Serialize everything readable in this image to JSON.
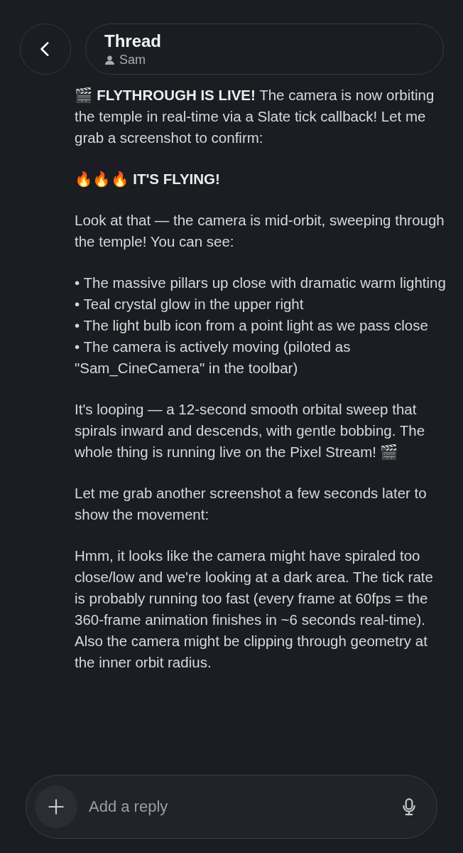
{
  "header": {
    "title": "Thread",
    "subtitle": "Sam"
  },
  "blocks": [
    {
      "kind": "text",
      "text": "🎬 **FLYTHROUGH IS LIVE!** The camera is now orbiting the temple in real-time via a Slate tick callback! Let me grab a screenshot to confirm:"
    },
    {
      "kind": "fire-heading",
      "text": "🔥🔥🔥 IT'S FLYING!"
    },
    {
      "kind": "text",
      "text": "Look at that — the camera is mid-orbit, sweeping through the temple! You can see:"
    },
    {
      "kind": "bullets",
      "items": [
        "• The massive pillars up close with dramatic warm lighting",
        "• Teal crystal glow in the upper right",
        "• The light bulb icon from a point light as we pass close",
        "• The camera is actively moving (piloted as \"Sam_CineCamera\" in the toolbar)"
      ]
    },
    {
      "kind": "text",
      "text": "It's looping — a 12-second smooth orbital sweep that spirals inward and descends, with gentle bobbing. The whole thing is running live on the Pixel Stream! 🎬"
    },
    {
      "kind": "text",
      "text": "Let me grab another screenshot a few seconds later to show the movement:"
    },
    {
      "kind": "text",
      "text": "Hmm, it looks like the camera might have spiraled too close/low and we're looking at a dark area. The tick rate is probably running too fast (every frame at 60fps = the 360-frame animation finishes in ~6 seconds real-time). Also the camera might be clipping through geometry at the inner orbit radius."
    }
  ],
  "composer": {
    "placeholder": "Add a reply"
  }
}
